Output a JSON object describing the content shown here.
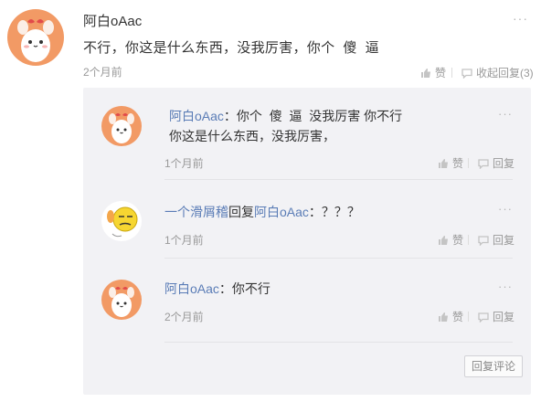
{
  "main": {
    "username": "阿白oAac",
    "text": "不行，你这是什么东西，没我厉害，你个  傻  逼",
    "time": "2个月前",
    "more": "···",
    "like_label": "赞",
    "collapse_label": "收起回复(3)"
  },
  "replies": [
    {
      "username": "阿白oAac",
      "colon": "：",
      "text_line1": "你个  傻  逼  没我厉害 你不行",
      "text_line2": "你这是什么东西，没我厉害，",
      "time": "1个月前",
      "like_label": "赞",
      "reply_label": "回复",
      "more": "···"
    },
    {
      "username": "一个滑屑稽",
      "reply_word": "回复",
      "target": "阿白oAac",
      "colon": "：",
      "text_line1": "？？？",
      "time": "1个月前",
      "like_label": "赞",
      "reply_label": "回复",
      "more": "···"
    },
    {
      "username": "阿白oAac",
      "colon": "：",
      "text_line1": "你不行",
      "time": "2个月前",
      "like_label": "赞",
      "reply_label": "回复",
      "more": "···"
    }
  ],
  "reply_comment_button": "回复评论",
  "colors": {
    "username_link": "#5a7cb6",
    "reply_bg": "#f2f2f5",
    "avatar_bg": "#f29a65"
  }
}
